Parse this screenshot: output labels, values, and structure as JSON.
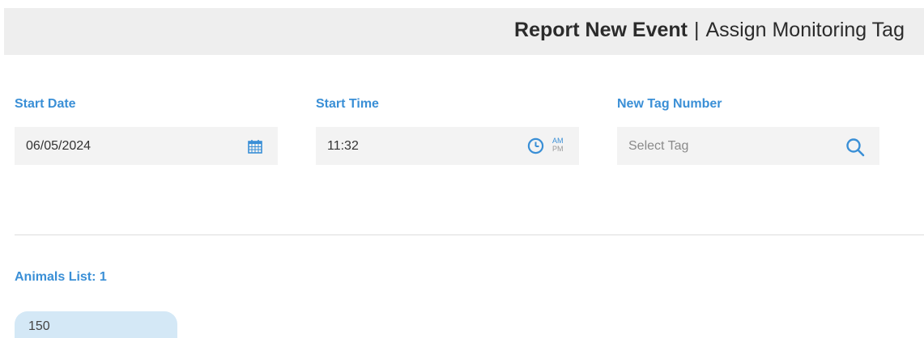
{
  "header": {
    "title_strong": "Report New Event",
    "separator": "|",
    "title_sub": "Assign Monitoring Tag"
  },
  "form": {
    "start_date": {
      "label": "Start Date",
      "value": "06/05/2024",
      "icon": "calendar-icon"
    },
    "start_time": {
      "label": "Start Time",
      "value": "11:32",
      "icon": "clock-icon",
      "am_label": "AM",
      "pm_label": "PM"
    },
    "new_tag_number": {
      "label": "New Tag Number",
      "placeholder": "Select Tag",
      "icon": "search-icon"
    }
  },
  "animals": {
    "list_label": "Animals List: 1",
    "items": [
      "150"
    ]
  },
  "colors": {
    "accent": "#3a8fd6",
    "header_bg": "#eeeeee",
    "field_bg": "#f3f3f3",
    "chip_bg": "#d4e8f6"
  }
}
